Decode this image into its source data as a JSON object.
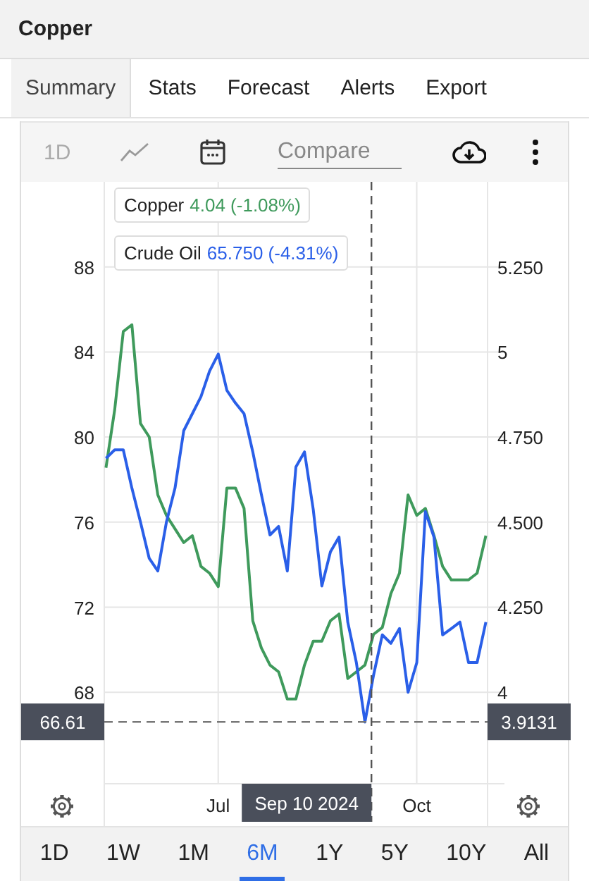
{
  "window": {
    "title": "Copper"
  },
  "tabs": [
    {
      "label": "Summary",
      "selected": true
    },
    {
      "label": "Stats",
      "selected": false
    },
    {
      "label": "Forecast",
      "selected": false
    },
    {
      "label": "Alerts",
      "selected": false
    },
    {
      "label": "Export",
      "selected": false
    }
  ],
  "toolbar": {
    "interval": "1D",
    "compare": {
      "placeholder": "Compare"
    }
  },
  "chart": {
    "legend": [
      {
        "value": "4.04 (-1.08%)"
      },
      {
        "value": "65.750 (-4.31%)"
      }
    ],
    "chart_data": {
      "type": "line",
      "categories": [
        null,
        null,
        null,
        null,
        null,
        null,
        null,
        null,
        null,
        null,
        null,
        null,
        null,
        "Jul",
        null,
        null,
        null,
        null,
        null,
        null,
        null,
        null,
        null,
        null,
        null,
        null,
        null,
        null,
        null,
        null,
        null,
        null,
        null,
        null,
        null,
        null,
        "Oct",
        null,
        null,
        null,
        null,
        null,
        null,
        null,
        null
      ],
      "ylim": [
        63.7,
        92
      ],
      "yticks": [
        68,
        72,
        76,
        80,
        84,
        88
      ],
      "y2lim": [
        3.731,
        5.5
      ],
      "y2ticks": [
        {
          "value": 4,
          "label": "4"
        },
        {
          "value": 4.25,
          "label": "4.250"
        },
        {
          "value": 4.5,
          "label": "4.500"
        },
        {
          "value": 4.75,
          "label": "4.750"
        },
        {
          "value": 5,
          "label": "5"
        },
        {
          "value": 5.25,
          "label": "5.250"
        }
      ],
      "series": [
        {
          "name": "Copper",
          "color": "#3f9a5c",
          "axis": "y2",
          "values": [
            4.66,
            4.83,
            5.06,
            5.08,
            4.79,
            4.75,
            4.58,
            4.52,
            4.48,
            4.44,
            4.46,
            4.37,
            4.35,
            4.31,
            4.6,
            4.6,
            4.54,
            4.21,
            4.13,
            4.08,
            4.06,
            3.98,
            3.98,
            4.08,
            4.15,
            4.15,
            4.21,
            4.23,
            4.04,
            4.06,
            4.08,
            4.17,
            4.19,
            4.29,
            4.35,
            4.58,
            4.52,
            4.54,
            4.46,
            4.37,
            4.33,
            4.33,
            4.33,
            4.35,
            4.46
          ]
        },
        {
          "name": "Crude Oil",
          "color": "#2a5fe8",
          "values": [
            79.0,
            79.4,
            79.4,
            77.6,
            76.0,
            74.3,
            73.7,
            76.0,
            77.6,
            80.3,
            81.1,
            81.9,
            83.1,
            83.9,
            82.2,
            81.6,
            81.1,
            79.3,
            77.3,
            75.4,
            75.8,
            73.7,
            78.6,
            79.3,
            76.6,
            73.0,
            74.6,
            75.3,
            71.3,
            69.4,
            66.6,
            68.8,
            70.7,
            70.3,
            71.0,
            68.0,
            69.4,
            76.5,
            75.3,
            70.7,
            71.0,
            71.3,
            69.4,
            69.4,
            71.3
          ]
        }
      ],
      "grid": true,
      "ref_lines": [
        {
          "axis": "y",
          "value": 66.61
        }
      ],
      "annotations": [
        "Sep 10 2024",
        "66.61",
        "3.9131"
      ]
    }
  },
  "ranges": [
    {
      "label": "1D",
      "selected": false
    },
    {
      "label": "1W",
      "selected": false
    },
    {
      "label": "1M",
      "selected": false
    },
    {
      "label": "6M",
      "selected": true
    },
    {
      "label": "1Y",
      "selected": false
    },
    {
      "label": "5Y",
      "selected": false
    },
    {
      "label": "10Y",
      "selected": false
    },
    {
      "label": "All",
      "selected": false
    }
  ]
}
